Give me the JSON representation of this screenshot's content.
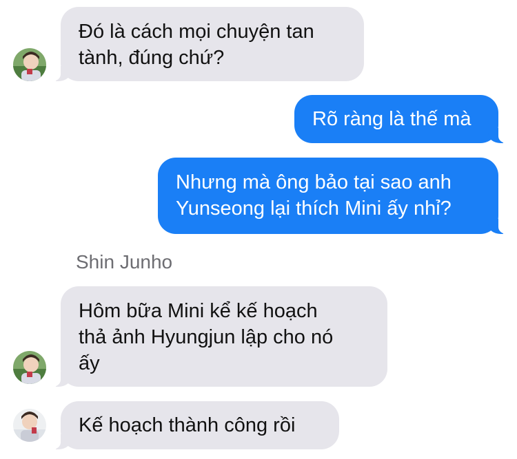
{
  "messages": [
    {
      "direction": "incoming",
      "text": "Đó là cách mọi chuyện tan\ntành, đúng chứ?"
    },
    {
      "direction": "outgoing",
      "text": "Rõ ràng là thế mà"
    },
    {
      "direction": "outgoing",
      "text": "Nhưng mà ông bảo tại sao anh\nYunseong lại thích Mini ấy nhỉ?"
    },
    {
      "direction": "incoming",
      "text": "Hôm bữa Mini kể kế hoạch\nthả ảnh Hyungjun lập cho nó\nấy"
    },
    {
      "direction": "incoming",
      "text": "Kế hoạch thành công rồi"
    }
  ],
  "sender_name": "Shin Junho",
  "colors": {
    "incoming_bubble": "#e6e5eb",
    "outgoing_bubble": "#1a7ff6",
    "sender_name": "#6d6d72"
  },
  "icons": {
    "avatar": "contact-avatar-photo"
  }
}
